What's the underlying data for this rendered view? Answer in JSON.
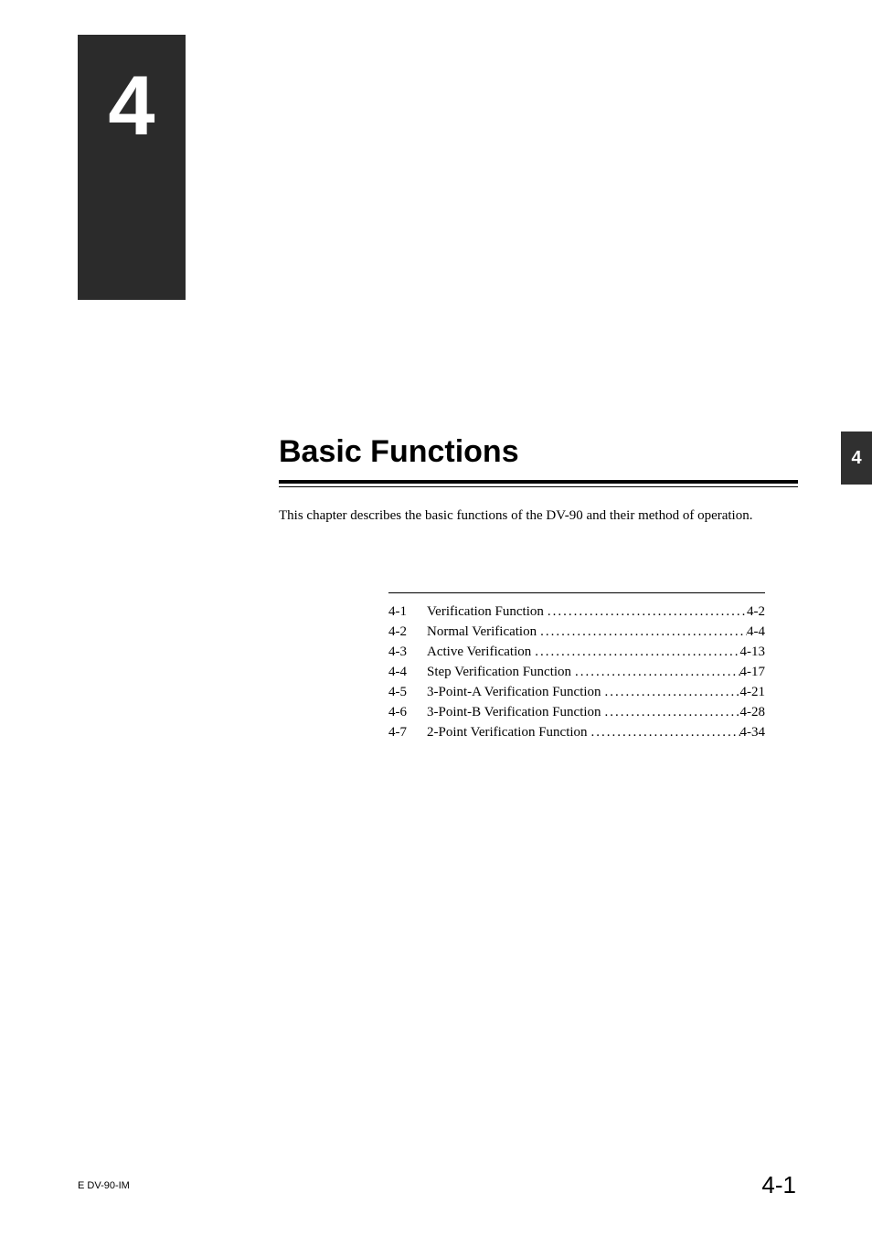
{
  "chapter": {
    "number": "4",
    "tab": "4",
    "title": "Basic Functions",
    "description": "This chapter describes the basic functions of the DV-90 and their method of operation."
  },
  "toc": [
    {
      "num": "4-1",
      "label": "Verification Function",
      "page": "4-2"
    },
    {
      "num": "4-2",
      "label": "Normal Verification",
      "page": "4-4"
    },
    {
      "num": "4-3",
      "label": "Active Verification",
      "page": "4-13"
    },
    {
      "num": "4-4",
      "label": "Step Verification Function",
      "page": "4-17"
    },
    {
      "num": "4-5",
      "label": "3-Point-A Verification Function",
      "page": "4-21"
    },
    {
      "num": "4-6",
      "label": "3-Point-B Verification Function",
      "page": "4-28"
    },
    {
      "num": "4-7",
      "label": "2-Point Verification Function",
      "page": "4-34"
    }
  ],
  "footer": {
    "left": "E DV-90-IM",
    "right": "4-1"
  }
}
